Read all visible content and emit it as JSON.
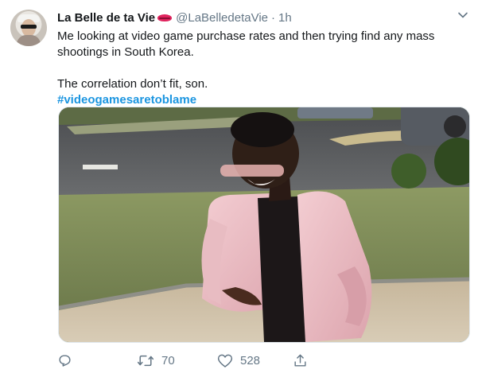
{
  "tweet": {
    "display_name": "La Belle de ta Vie",
    "handle": "@LaBelledetaVie",
    "separator": "·",
    "time": "1h",
    "text_line1": "Me looking at video game purchase rates and then trying find any mass shootings in South Korea.",
    "text_line2": "The correlation don’t fit, son.",
    "hashtag": "#videogamesaretoblame"
  },
  "actions": {
    "reply_count": "",
    "retweet_count": "70",
    "like_count": "528"
  },
  "icons": {
    "name_emoji": "kiss-mark-icon",
    "menu": "chevron-down-icon",
    "reply": "reply-icon",
    "retweet": "retweet-icon",
    "like": "heart-icon",
    "share": "share-icon"
  },
  "colors": {
    "link": "#1b95e0",
    "secondary_text": "#657786",
    "primary_text": "#14171a"
  }
}
